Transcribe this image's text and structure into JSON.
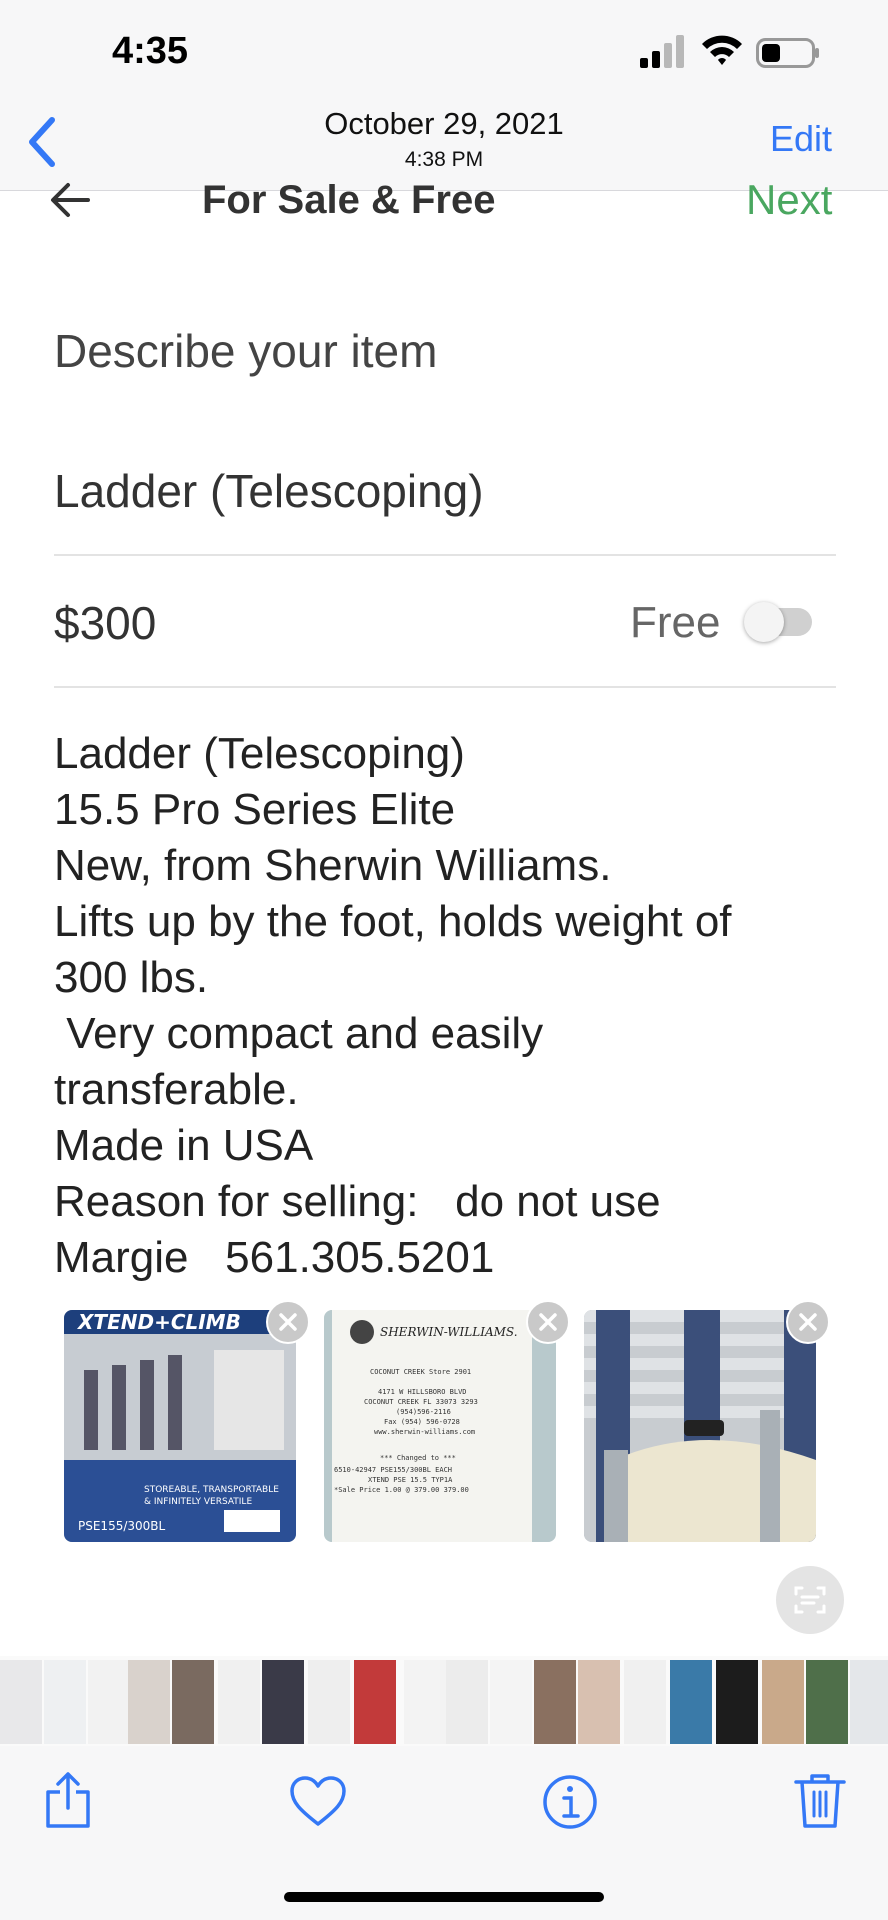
{
  "status_bar": {
    "time": "4:35"
  },
  "nav": {
    "date": "October 29, 2021",
    "time": "4:38 PM",
    "edit_label": "Edit"
  },
  "app": {
    "title": "For Sale & Free",
    "next_label": "Next",
    "section_label": "Describe your item",
    "item_title": "Ladder (Telescoping)",
    "price": "$300",
    "free_label": "Free",
    "free_toggle_on": false,
    "description_lines": [
      "Ladder (Telescoping)",
      "15.5 Pro Series Elite",
      "New, from Sherwin Williams.",
      "Lifts up by the foot, holds weight of",
      "300 lbs.",
      " Very compact and easily",
      "transferable.",
      "Made in USA",
      "Reason for selling:   do not use",
      "Margie   561.305.5201"
    ],
    "photos": [
      {
        "label": "XTEND+CLIMB",
        "text1": "STOREABLE, TRANSPORTABLE",
        "text2": "& INFINITELY VERSATILE",
        "text3": "PSE155/300BL"
      },
      {
        "label": "SHERWIN-WILLIAMS.",
        "lines": [
          "COCONUT CREEK Store 2901",
          "4171 W HILLSBORO BLVD",
          "COCONUT CREEK FL 33073 3293",
          "(954)596-2116",
          "Fax (954) 596-0728",
          "www.sherwin-williams.com",
          "*** Changed to ***",
          "6510-42947 PSE155/300BL EACH",
          "XTEND PSE 15.5 TYP1A",
          "*Sale Price  1.00 @  379.00  379.00"
        ]
      },
      {
        "label": "ladder-photo"
      }
    ]
  },
  "colors": {
    "ios_blue": "#3478f6",
    "next_green": "#4aa760"
  }
}
